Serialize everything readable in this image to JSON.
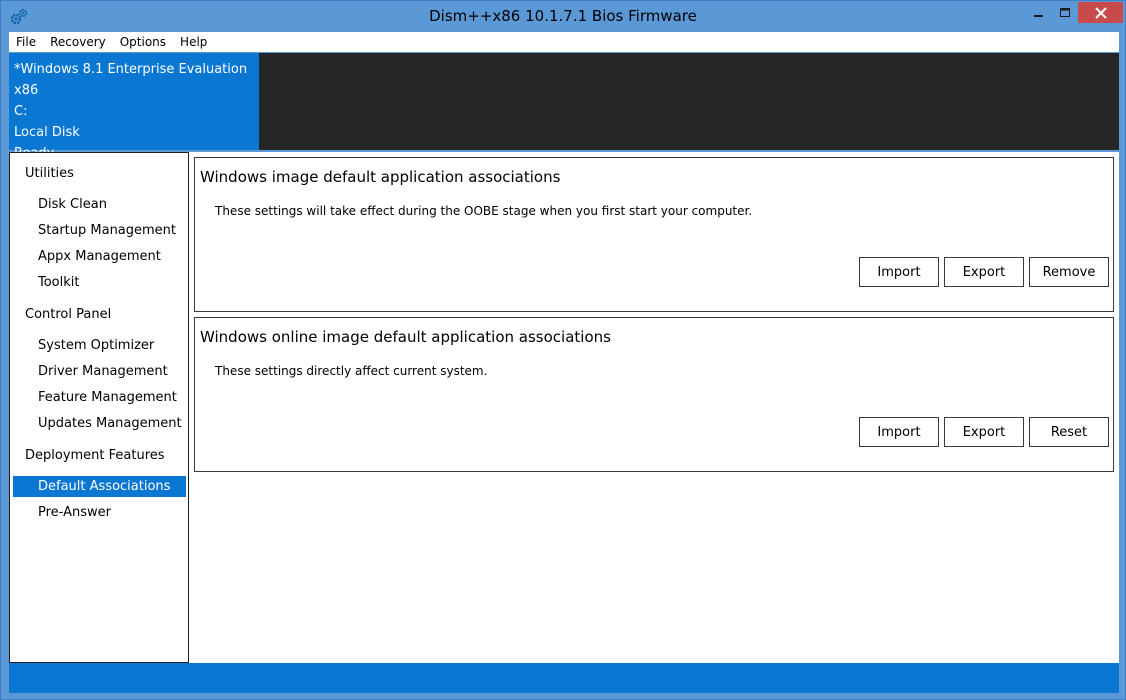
{
  "window": {
    "title": "Dism++x86 10.1.7.1 Bios Firmware",
    "accent_color": "#0a78d2"
  },
  "menu": [
    "File",
    "Recovery",
    "Options",
    "Help"
  ],
  "info": {
    "os": "*Windows 8.1 Enterprise Evaluation x86",
    "drive": "C:",
    "disk": "Local Disk",
    "status": "Ready"
  },
  "sidebar": {
    "sections": [
      {
        "header": "Utilities",
        "items": [
          "Disk Clean",
          "Startup Management",
          "Appx Management",
          "Toolkit"
        ]
      },
      {
        "header": "Control Panel",
        "items": [
          "System Optimizer",
          "Driver Management",
          "Feature Management",
          "Updates Management"
        ]
      },
      {
        "header": "Deployment Features",
        "items": [
          "Default Associations",
          "Pre-Answer"
        ]
      }
    ],
    "selected": "Default Associations"
  },
  "cards": [
    {
      "title": "Windows image default application associations",
      "description": "These settings will take effect during the OOBE stage when you first start your computer.",
      "buttons": [
        "Import",
        "Export",
        "Remove"
      ]
    },
    {
      "title": "Windows online image default application associations",
      "description": "These settings directly affect current system.",
      "buttons": [
        "Import",
        "Export",
        "Reset"
      ]
    }
  ]
}
